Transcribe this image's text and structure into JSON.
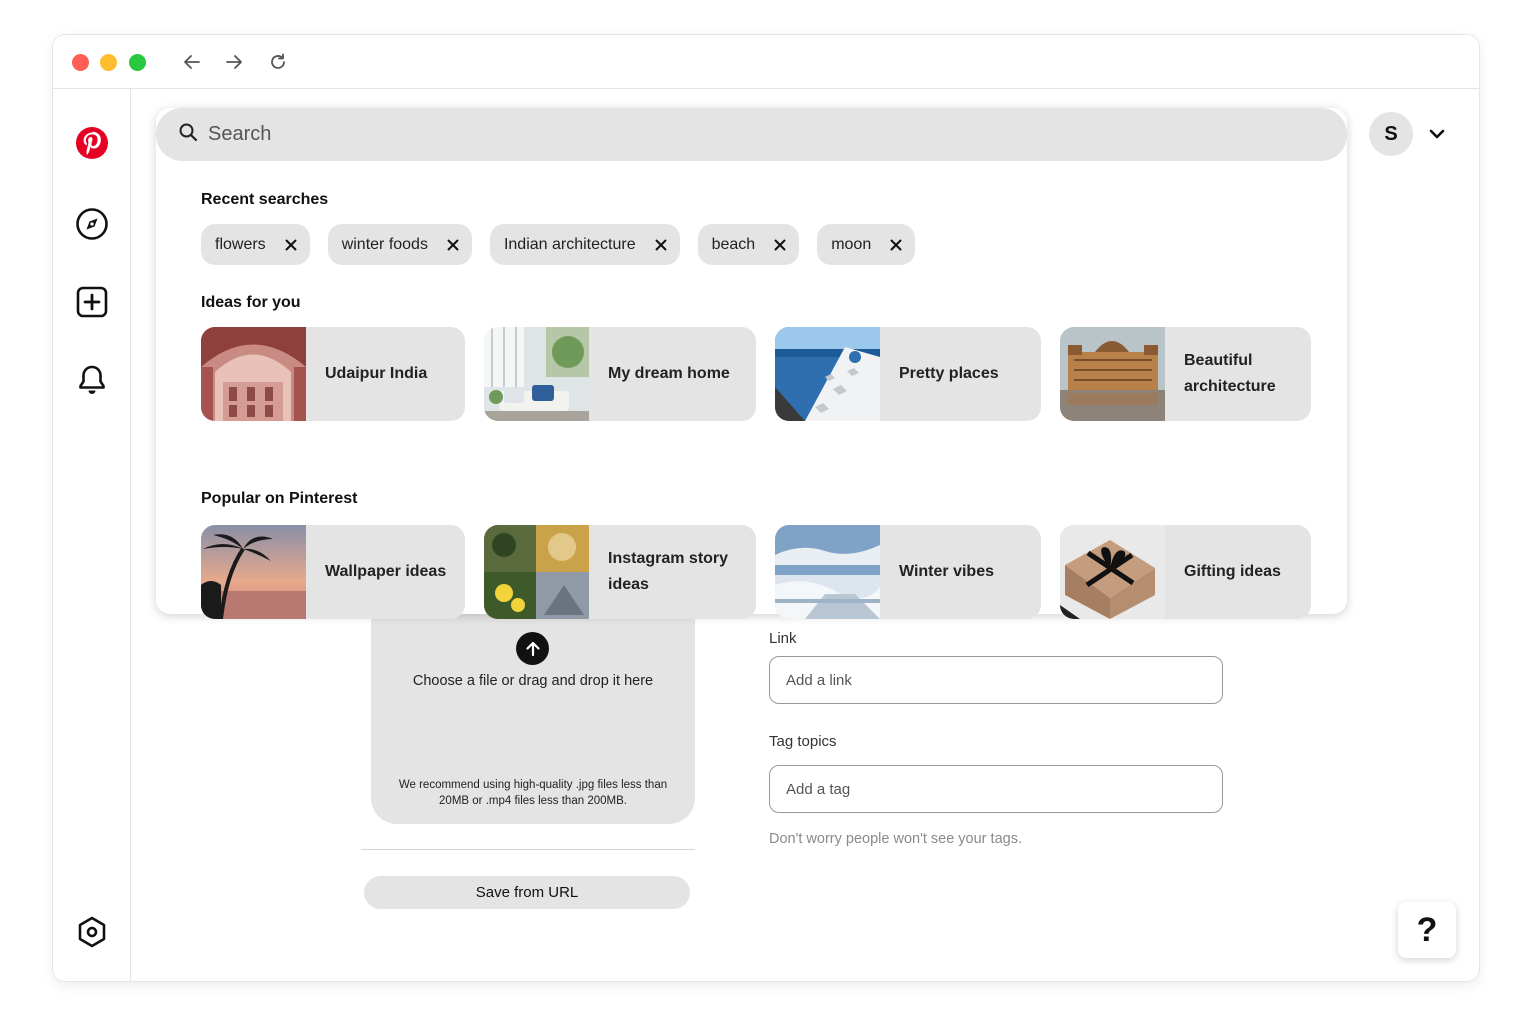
{
  "search": {
    "placeholder": "Search"
  },
  "user": {
    "initial": "S"
  },
  "recent": {
    "title": "Recent searches",
    "items": [
      "flowers",
      "winter foods",
      "Indian architecture",
      "beach",
      "moon"
    ]
  },
  "ideas": {
    "title": "Ideas for you",
    "cards": [
      {
        "label": "Udaipur India"
      },
      {
        "label": "My dream home"
      },
      {
        "label": "Pretty places"
      },
      {
        "label": "Beautiful architecture"
      }
    ]
  },
  "popular": {
    "title": "Popular on Pinterest",
    "cards": [
      {
        "label": "Wallpaper ideas"
      },
      {
        "label": "Instagram story ideas"
      },
      {
        "label": "Winter vibes"
      },
      {
        "label": "Gifting ideas"
      }
    ]
  },
  "upload": {
    "main_text": "Choose a file or drag and drop it here",
    "note": "We recommend using high-quality .jpg files less than 20MB or .mp4 files less than 200MB.",
    "save_from_url": "Save from URL"
  },
  "form": {
    "link_label": "Link",
    "link_placeholder": "Add a link",
    "tag_label": "Tag topics",
    "tag_placeholder": "Add a tag",
    "tag_hint": "Don't worry people won't see your tags."
  },
  "help": {
    "label": "?"
  },
  "colors": {
    "brand": "#e60023",
    "chip_bg": "#e4e4e4"
  },
  "icons": {
    "logo": "pinterest-logo-icon",
    "explore": "compass-icon",
    "create": "plus-square-icon",
    "notifications": "bell-icon",
    "settings": "hexagon-settings-icon"
  }
}
